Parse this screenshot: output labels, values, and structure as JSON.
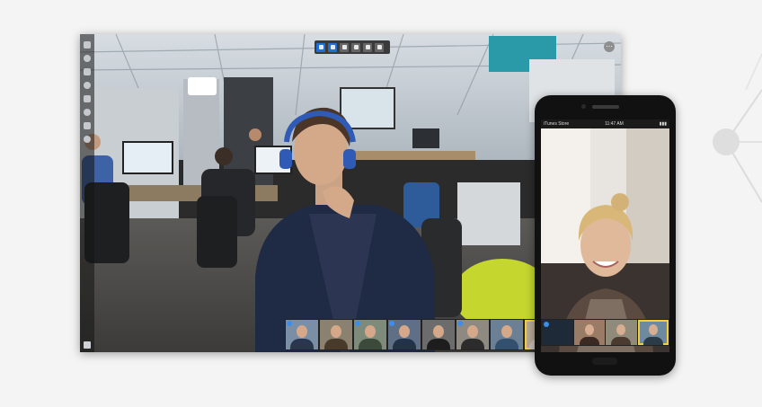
{
  "desktop": {
    "sidebar_icons": [
      "logo-icon",
      "chat-icon",
      "camera-icon",
      "record-icon",
      "settings-icon",
      "share-icon",
      "info-icon",
      "people-icon"
    ],
    "toolbar": {
      "buttons": [
        {
          "name": "tab-pointer",
          "active": true
        },
        {
          "name": "tab-video",
          "active": true
        },
        {
          "name": "tab-screen",
          "active": false
        },
        {
          "name": "tab-window",
          "active": false
        },
        {
          "name": "tab-layout",
          "active": false
        },
        {
          "name": "tab-more",
          "active": false
        }
      ]
    },
    "corner_button_glyph": "⋯",
    "filmstrip": [
      {
        "color": "#7a8ea6",
        "shirt": "#2a3550",
        "badge": true,
        "selected": false
      },
      {
        "color": "#8a8170",
        "shirt": "#4a3a2a",
        "badge": false,
        "selected": false
      },
      {
        "color": "#7e8a7a",
        "shirt": "#3b4a3b",
        "badge": true,
        "selected": false
      },
      {
        "color": "#5e6f86",
        "shirt": "#22324a",
        "badge": true,
        "selected": false
      },
      {
        "color": "#6c6c6c",
        "shirt": "#1d1d1d",
        "badge": false,
        "selected": false
      },
      {
        "color": "#8e8a82",
        "shirt": "#2c2c2c",
        "badge": true,
        "selected": false
      },
      {
        "color": "#6b7f95",
        "shirt": "#33506e",
        "badge": false,
        "selected": false
      },
      {
        "color": "#b7a995",
        "shirt": "#c7c0b5",
        "badge": false,
        "selected": true
      }
    ]
  },
  "phone": {
    "status": {
      "carrier": "iTunes Store",
      "time": "11:47 AM",
      "battery": "▮▮▮"
    },
    "thumbs": [
      {
        "color": "#1e2a38",
        "shirt": "#0f1720",
        "badge": true,
        "selected": false,
        "empty": true
      },
      {
        "color": "#9a7b66",
        "shirt": "#3b2a22",
        "badge": false,
        "selected": false
      },
      {
        "color": "#8f8a7a",
        "shirt": "#4a3a2f",
        "badge": false,
        "selected": false
      },
      {
        "color": "#6f8a9e",
        "shirt": "#2c3b48",
        "badge": false,
        "selected": true
      }
    ]
  }
}
